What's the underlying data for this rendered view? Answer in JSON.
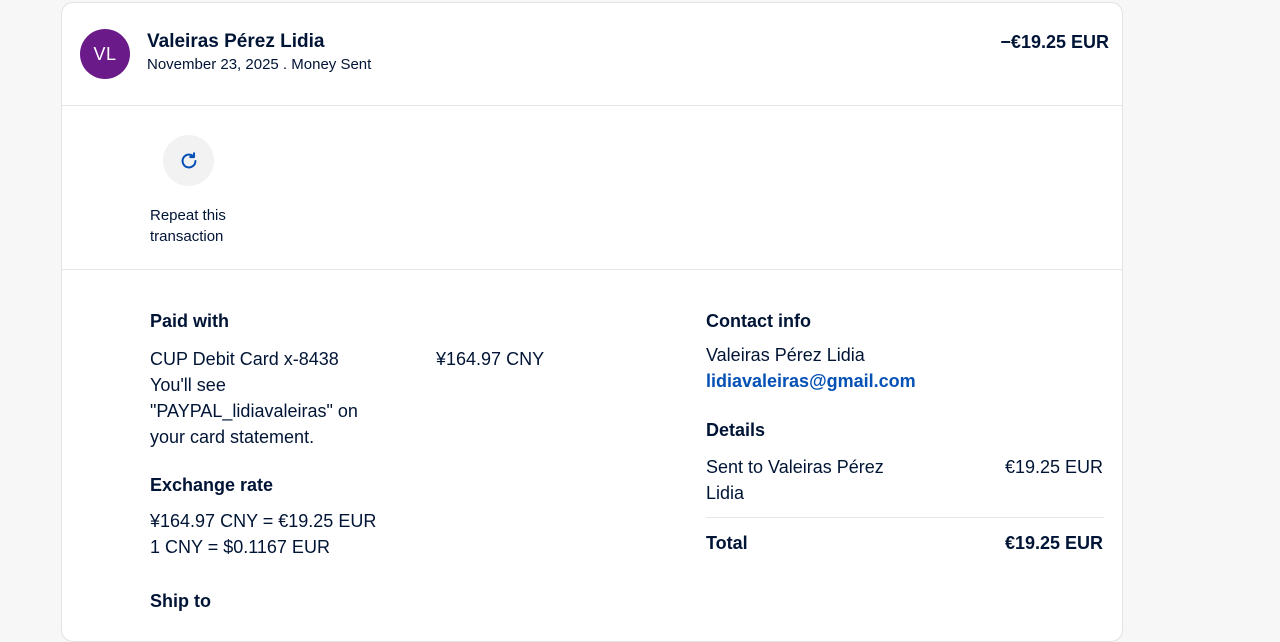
{
  "transaction": {
    "avatar_initials": "VL",
    "name": "Valeiras Pérez Lidia",
    "date": "November 23, 2025",
    "separator": " . ",
    "type": "Money Sent",
    "amount": "−€19.25 EUR"
  },
  "actions": {
    "repeat_label_line1": "Repeat this",
    "repeat_label_line2": "transaction",
    "repeat_icon": "refresh-icon"
  },
  "paid_with": {
    "title": "Paid with",
    "card": "CUP Debit Card x-8438",
    "card_amount": "¥164.97 CNY",
    "note_line1": "You'll see",
    "note_line2": "\"PAYPAL_lidiavaleiras\" on",
    "note_line3": "your card statement."
  },
  "exchange_rate": {
    "title": "Exchange rate",
    "line1": "¥164.97 CNY = €19.25 EUR",
    "line2": "1 CNY = $0.1167 EUR"
  },
  "ship_to": {
    "title": "Ship to"
  },
  "contact_info": {
    "title": "Contact info",
    "name": "Valeiras Pérez Lidia",
    "email": "lidiavaleiras@gmail.com"
  },
  "details": {
    "title": "Details",
    "sent_to_line1": "Sent to Valeiras Pérez",
    "sent_to_line2": "Lidia",
    "sent_amount": "€19.25 EUR",
    "total_label": "Total",
    "total_amount": "€19.25 EUR"
  },
  "colors": {
    "avatar_bg": "#6b1a8a",
    "text": "#001435",
    "link": "#0551b5"
  }
}
